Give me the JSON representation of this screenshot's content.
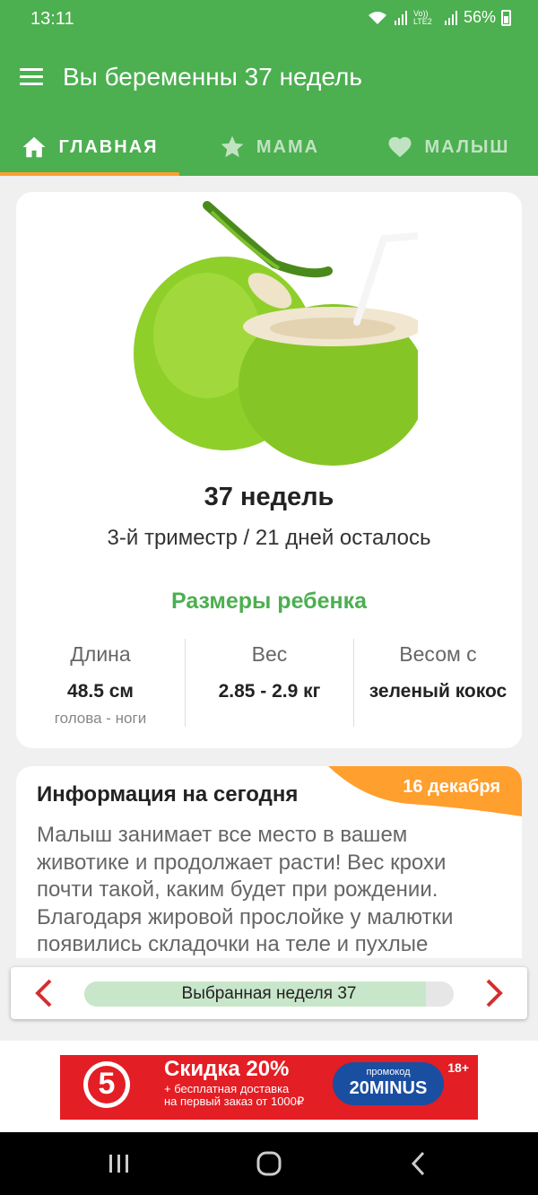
{
  "status_bar": {
    "time": "13:11",
    "network_label": "Vo)) LTE2",
    "battery": "56%"
  },
  "app_bar": {
    "title": "Вы беременны 37 недель"
  },
  "tabs": [
    {
      "label": "ГЛАВНАЯ",
      "icon": "home-icon",
      "active": true
    },
    {
      "label": "МАМА",
      "icon": "star-icon",
      "active": false
    },
    {
      "label": "МАЛЫШ",
      "icon": "heart-icon",
      "active": false
    }
  ],
  "week_card": {
    "image": "green-coconut",
    "week_title": "37 недель",
    "trimester_text": "3-й триместр / 21 дней осталось",
    "sizes_title": "Размеры ребенка",
    "metrics": [
      {
        "label": "Длина",
        "value": "48.5 см",
        "sub": "голова - ноги"
      },
      {
        "label": "Вес",
        "value": "2.85 - 2.9 кг",
        "sub": ""
      },
      {
        "label": "Весом с",
        "value": "зеленый кокос",
        "sub": ""
      }
    ]
  },
  "info_card": {
    "title": "Информация на сегодня",
    "date": "16 декабря",
    "text": "Малыш занимает все место в вашем животике и продолжает расти! Вес крохи почти такой, каким будет при рождении. Благодаря жировой прослойке у малютки появились складочки на теле и пухлые"
  },
  "week_nav": {
    "label": "Выбранная неделя 37",
    "progress": 0.925
  },
  "ad": {
    "logo_text": "5",
    "discount": "Скидка 20%",
    "sub_line1": "+ бесплатная доставка",
    "sub_line2": "на первый заказ от 1000₽",
    "promo_label": "промокод",
    "promo_code": "20MINUS",
    "age": "18+"
  },
  "colors": {
    "primary": "#4caf50",
    "accent": "#ff9f2e",
    "arrow": "#d32f2f",
    "progress_fill": "#c8e6c9",
    "ad_red": "#e31e24"
  }
}
